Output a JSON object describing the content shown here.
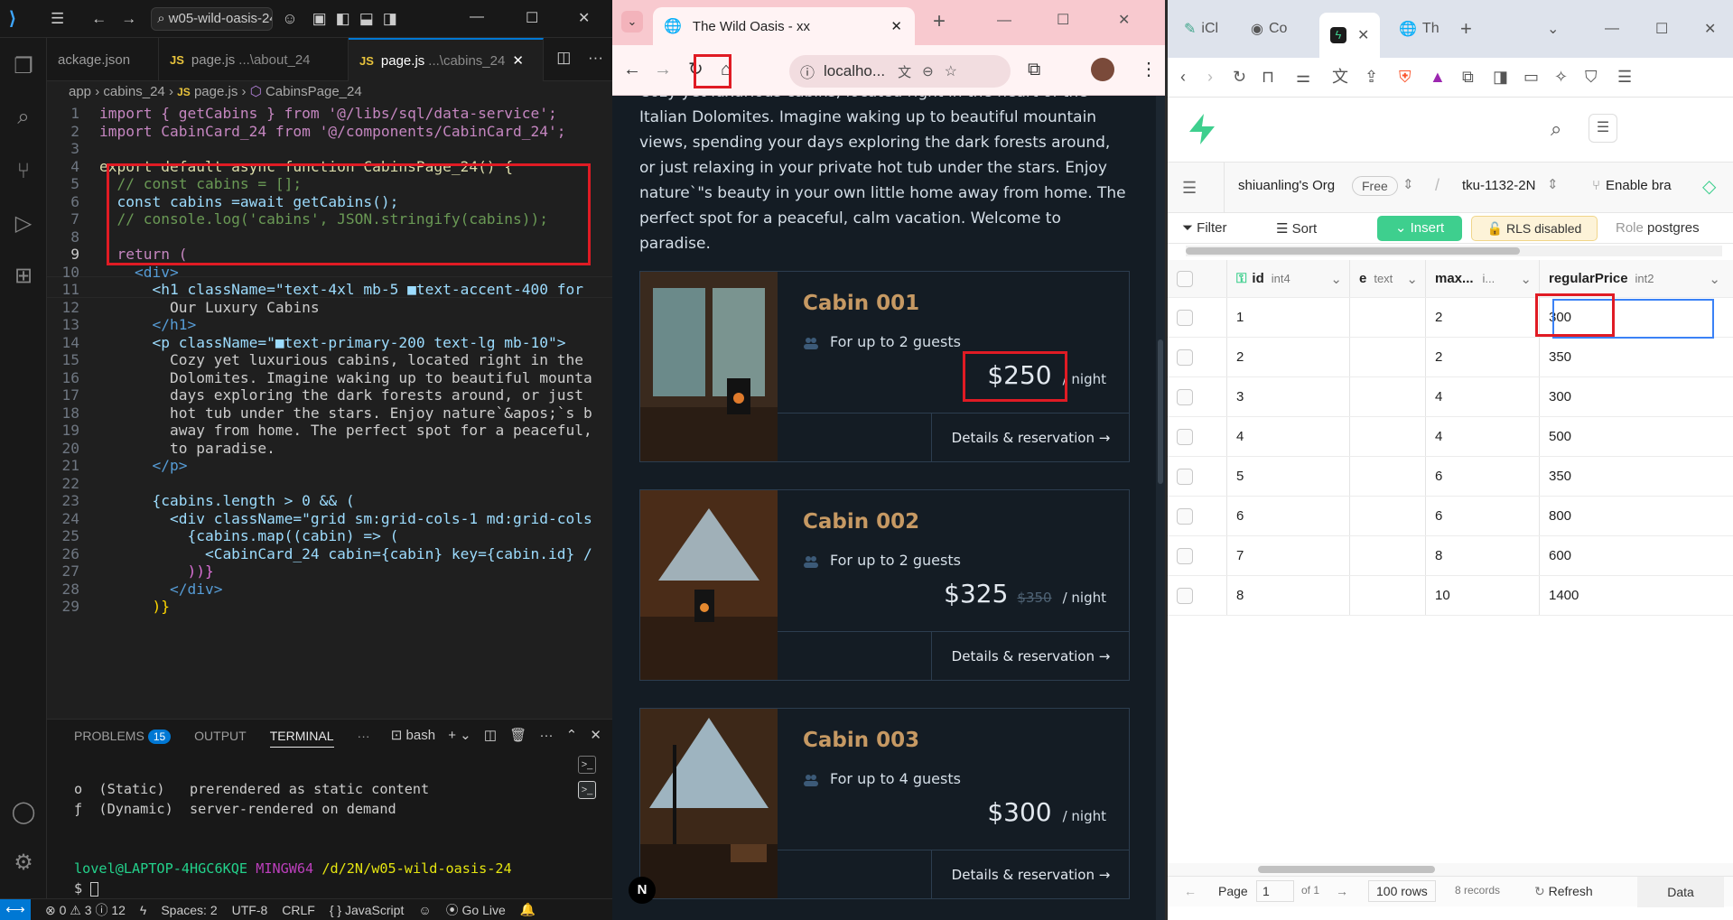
{
  "vscode": {
    "search_text": "w05-wild-oasis-24",
    "tabs": [
      {
        "label": "ackage.json",
        "dim": ""
      },
      {
        "label": "page.js",
        "dim": "...\\about_24"
      },
      {
        "label": "page.js",
        "dim": "...\\cabins_24"
      }
    ],
    "tab_js": "JS",
    "breadcrumb": {
      "folder1": "app",
      "folder2": "cabins_24",
      "file": "page.js",
      "symbol": "CabinsPage_24"
    },
    "code": {
      "l1": "import { getCabins } from '@/libs/sql/data-service';",
      "l2": "import CabinCard_24 from '@/components/CabinCard_24';",
      "l4": "export default async function CabinsPage_24() {",
      "l5": "  // const cabins = [];",
      "l6": "  const cabins =await getCabins();",
      "l7": "  // console.log('cabins', JSON.stringify(cabins));",
      "l9": "  return (",
      "l10": "    <div>",
      "l11": "      <h1 className=\"text-4xl mb-5 ■text-accent-400 for",
      "l12": "        Our Luxury Cabins",
      "l13": "      </h1>",
      "l14": "      <p className=\"■text-primary-200 text-lg mb-10\">",
      "l15": "        Cozy yet luxurious cabins, located right in the",
      "l16": "        Dolomites. Imagine waking up to beautiful mounta",
      "l17": "        days exploring the dark forests around, or just",
      "l18": "        hot tub under the stars. Enjoy nature`&apos;`s b",
      "l19": "        away from home. The perfect spot for a peaceful,",
      "l20": "        to paradise.",
      "l21": "      </p>",
      "l23": "      {cabins.length > 0 && (",
      "l24": "        <div className=\"grid sm:grid-cols-1 md:grid-cols",
      "l25": "          {cabins.map((cabin) => (",
      "l26": "            <CabinCard_24 cabin={cabin} key={cabin.id} /",
      "l27": "          ))}",
      "l28": "        </div>",
      "l29": "      )}"
    },
    "line_numbers": [
      "1",
      "2",
      "3",
      "4",
      "5",
      "6",
      "7",
      "8",
      "9",
      "10",
      "11",
      "12",
      "13",
      "14",
      "15",
      "16",
      "17",
      "18",
      "19",
      "20",
      "21",
      "22",
      "23",
      "24",
      "25",
      "26",
      "27",
      "28",
      "29"
    ],
    "panel_tabs": {
      "problems": "PROBLEMS",
      "problems_count": "15",
      "output": "OUTPUT",
      "terminal": "TERMINAL",
      "bash": "bash"
    },
    "terminal": {
      "line1": "o  (Static)   prerendered as static content",
      "line2": "ƒ  (Dynamic)  server-rendered on demand",
      "user": "lovel@LAPTOP-4HGC6KQE",
      "env": "MINGW64",
      "path": "/d/2N/w05-wild-oasis-24",
      "prompt": "$"
    },
    "status": {
      "errors": "0",
      "warnings": "3",
      "info": "12",
      "spaces": "Spaces: 2",
      "encoding": "UTF-8",
      "eol": "CRLF",
      "lang": "JavaScript",
      "golive": "Go Live"
    }
  },
  "browser1": {
    "tab_title": "The Wild Oasis - xx",
    "url": "localho...",
    "intro": "Cozy yet luxurious cabins, located right in the heart of the Italian Dolomites. Imagine waking up to beautiful mountain views, spending your days exploring the dark forests around, or just relaxing in your private hot tub under the stars. Enjoy nature`\"s beauty in your own little home away from home. The perfect spot for a peaceful, calm vacation. Welcome to paradise.",
    "cabins": [
      {
        "name": "Cabin 001",
        "guests": "For up to 2 guests",
        "guests_n": "2",
        "price": "$250",
        "old": "",
        "per": "/ night",
        "details": "Details & reservation →"
      },
      {
        "name": "Cabin 002",
        "guests": "For up to 2 guests",
        "guests_n": "2",
        "price": "$325",
        "old": "$350",
        "per": "/ night",
        "details": "Details & reservation →"
      },
      {
        "name": "Cabin 003",
        "guests": "For up to 4 guests",
        "guests_n": "4",
        "price": "$300",
        "old": "",
        "per": "/ night",
        "details": "Details & reservation →"
      }
    ],
    "n_badge": "N"
  },
  "browser2": {
    "tabs": [
      "iCl",
      "Co",
      "",
      "Th"
    ],
    "org": "shiuanling's Org",
    "plan": "Free",
    "project": "tku-1132-2N",
    "branching": "Enable bra",
    "filter": "Filter",
    "sort": "Sort",
    "insert": "Insert",
    "rls": "RLS disabled",
    "role_label": "Role",
    "role": "postgres",
    "columns": {
      "id": "id",
      "id_type": "int4",
      "desc": "e",
      "desc_type": "text",
      "max": "max...",
      "max_type": "i...",
      "price": "regularPrice",
      "price_type": "int2"
    },
    "rows": [
      {
        "id": "1",
        "max": "2",
        "price": "300"
      },
      {
        "id": "2",
        "max": "2",
        "price": "350"
      },
      {
        "id": "3",
        "max": "4",
        "price": "300"
      },
      {
        "id": "4",
        "max": "4",
        "price": "500"
      },
      {
        "id": "5",
        "max": "6",
        "price": "350"
      },
      {
        "id": "6",
        "max": "6",
        "price": "800"
      },
      {
        "id": "7",
        "max": "8",
        "price": "600"
      },
      {
        "id": "8",
        "max": "10",
        "price": "1400"
      }
    ],
    "footer": {
      "page": "Page",
      "page_num": "1",
      "of": "of 1",
      "rows": "100 rows",
      "records": "8 records",
      "refresh": "Refresh",
      "data": "Data"
    }
  }
}
